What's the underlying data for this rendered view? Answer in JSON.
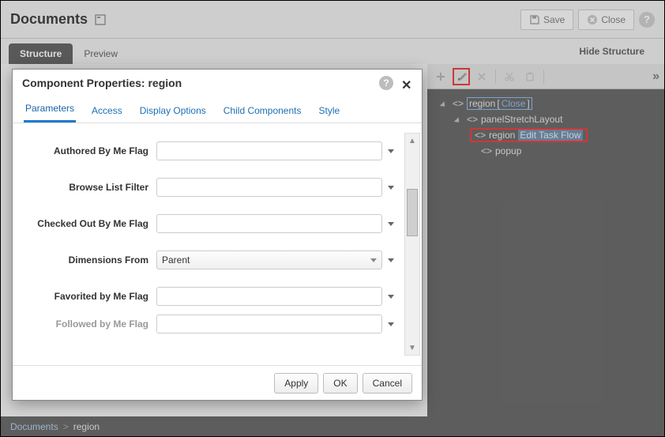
{
  "header": {
    "title": "Documents",
    "save_label": "Save",
    "close_label": "Close"
  },
  "tabs": {
    "structure": "Structure",
    "preview": "Preview",
    "hide_structure": "Hide Structure"
  },
  "tree": {
    "region_label": "region",
    "region_action": "Close",
    "panelStretch": "panelStretchLayout",
    "region2_label": "region",
    "region2_action": "Edit Task Flow",
    "popup": "popup"
  },
  "breadcrumb": {
    "root": "Documents",
    "current": "region"
  },
  "modal": {
    "title": "Component Properties: region",
    "tabs": {
      "parameters": "Parameters",
      "access": "Access",
      "display_options": "Display Options",
      "child_components": "Child Components",
      "style": "Style"
    },
    "params": [
      {
        "label": "Authored By Me Flag",
        "value": "",
        "type": "text"
      },
      {
        "label": "Browse List Filter",
        "value": "",
        "type": "text"
      },
      {
        "label": "Checked Out By Me Flag",
        "value": "",
        "type": "text"
      },
      {
        "label": "Dimensions From",
        "value": "Parent",
        "type": "select"
      },
      {
        "label": "Favorited by Me Flag",
        "value": "",
        "type": "text"
      },
      {
        "label": "Followed by Me Flag",
        "value": "",
        "type": "text"
      }
    ],
    "footer": {
      "apply": "Apply",
      "ok": "OK",
      "cancel": "Cancel"
    }
  }
}
